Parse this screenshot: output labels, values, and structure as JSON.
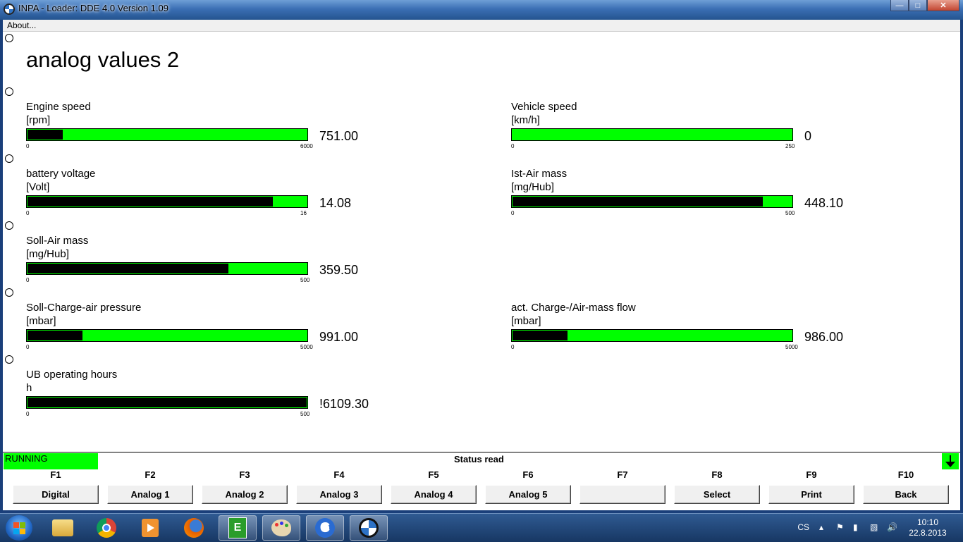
{
  "window": {
    "title": "INPA - Loader:  DDE 4.0 Version 1.09"
  },
  "menu": {
    "about": "About..."
  },
  "page": {
    "title": "analog values 2"
  },
  "gauges": [
    {
      "label": "Engine speed",
      "unit": "[rpm]",
      "value": "751.00",
      "min": "0",
      "max": "6000",
      "fill_fraction": 0.125
    },
    {
      "label": "Vehicle speed",
      "unit": "[km/h]",
      "value": "0",
      "min": "0",
      "max": "250",
      "fill_fraction": 0.0
    },
    {
      "label": "battery voltage",
      "unit": "[Volt]",
      "value": "14.08",
      "min": "0",
      "max": "16",
      "fill_fraction": 0.88
    },
    {
      "label": "Ist-Air mass",
      "unit": "[mg/Hub]",
      "value": "448.10",
      "min": "0",
      "max": "500",
      "fill_fraction": 0.896
    },
    {
      "label": "Soll-Air mass",
      "unit": "[mg/Hub]",
      "value": "359.50",
      "min": "0",
      "max": "500",
      "fill_fraction": 0.719
    },
    {
      "label": "Soll-Charge-air pressure",
      "unit": "[mbar]",
      "value": "991.00",
      "min": "0",
      "max": "5000",
      "fill_fraction": 0.198
    },
    {
      "label": "act. Charge-/Air-mass flow",
      "unit": "[mbar]",
      "value": "986.00",
      "min": "0",
      "max": "5000",
      "fill_fraction": 0.197
    },
    {
      "label": "UB operating hours",
      "unit": "h",
      "value": "!6109.30",
      "min": "0",
      "max": "500",
      "fill_fraction": 1.0
    }
  ],
  "status": {
    "state": "RUNNING",
    "message": "Status read",
    "state_color": "#00ff00"
  },
  "fkeys": [
    {
      "key": "F1",
      "label": "Digital"
    },
    {
      "key": "F2",
      "label": "Analog 1"
    },
    {
      "key": "F3",
      "label": "Analog 2"
    },
    {
      "key": "F4",
      "label": "Analog 3"
    },
    {
      "key": "F5",
      "label": "Analog 4"
    },
    {
      "key": "F6",
      "label": "Analog 5"
    },
    {
      "key": "F7",
      "label": ""
    },
    {
      "key": "F8",
      "label": "Select"
    },
    {
      "key": "F9",
      "label": "Print"
    },
    {
      "key": "F10",
      "label": "Back"
    }
  ],
  "taskbar": {
    "apps": [
      "windows-explorer",
      "chrome",
      "media-player",
      "firefox",
      "ediabas",
      "paint",
      "ccleaner",
      "inpa-bmw"
    ],
    "language": "CS",
    "time": "10:10",
    "date": "22.8.2013"
  },
  "colors": {
    "bar_bg": "#00ff00",
    "bar_fill": "#000000",
    "accent": "#00ff00"
  }
}
